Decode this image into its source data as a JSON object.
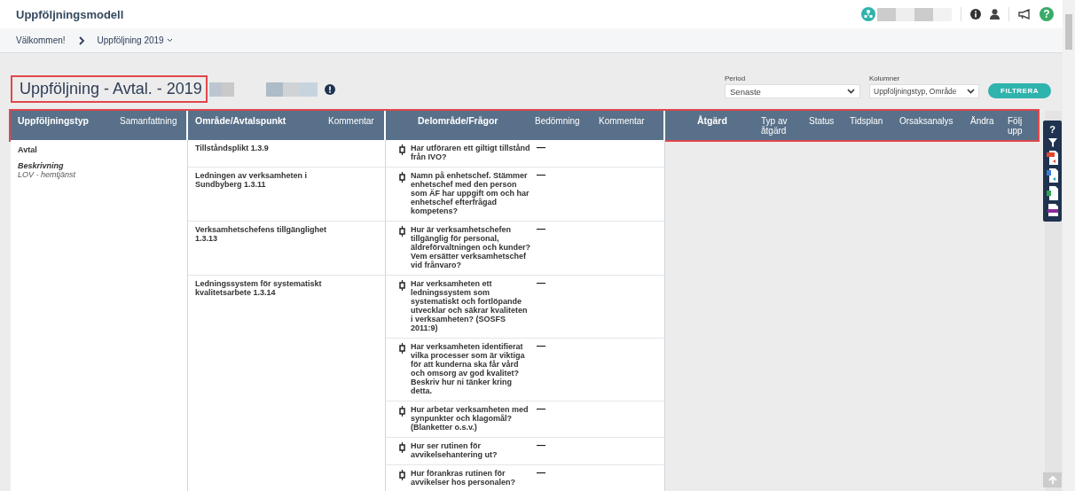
{
  "app": {
    "title": "Uppföljningsmodell",
    "help": "?"
  },
  "breadcrumb": [
    {
      "label": "Välkommen!",
      "has_menu": false
    },
    {
      "label": "Uppföljning 2019",
      "has_menu": true
    }
  ],
  "page_title": "Uppföljning - Avtal. - 2019",
  "filters": [
    {
      "label": "Period",
      "value": "Senaste"
    },
    {
      "label": "Kolumner",
      "value": "Uppföljningstyp, Område"
    }
  ],
  "filter_button": "FILTRERA",
  "table": {
    "column_groups": [
      {
        "columns": [
          {
            "label": "Uppföljningstyp",
            "primary": true
          },
          {
            "label": "Samanfattning",
            "primary": false
          }
        ]
      },
      {
        "columns": [
          {
            "label": "Område/Avtalspunkt",
            "primary": true
          },
          {
            "label": "Kommentar",
            "primary": false
          }
        ]
      },
      {
        "columns": [
          {
            "label": "Delområde/Frågor",
            "primary": true
          },
          {
            "label": "Bedömning",
            "primary": false
          },
          {
            "label": "Kommentar",
            "primary": false
          }
        ]
      },
      {
        "columns": [
          {
            "label": "Åtgärd",
            "primary": true
          },
          {
            "label": "Typ av åtgärd",
            "primary": false
          },
          {
            "label": "Status",
            "primary": false
          },
          {
            "label": "Tidsplan",
            "primary": false
          },
          {
            "label": "Orsaksanalys",
            "primary": false
          },
          {
            "label": "Ändra",
            "primary": false
          },
          {
            "label": "Följ upp",
            "primary": false
          }
        ]
      }
    ],
    "type": {
      "name": "Avtal",
      "description_label": "Beskrivning",
      "description": "LOV - hemtjänst"
    },
    "areas": [
      {
        "title": "Tillståndsplikt 1.3.9",
        "questions": [
          {
            "text": "Har utföraren ett giltigt tillstånd från IVO?",
            "assessment": "—"
          }
        ]
      },
      {
        "title": "Ledningen av verksamheten i Sundbyberg 1.3.11",
        "questions": [
          {
            "text": "Namn på enhetschef. Stämmer enhetschef med den person som ÄF har uppgift om och har enhetschef efterfrågad kompetens?",
            "assessment": "—"
          }
        ]
      },
      {
        "title": "Verksamhetschefens tillgänglighet 1.3.13",
        "questions": [
          {
            "text": "Hur är verksamhetschefen tillgänglig för personal, äldreförvaltningen och kunder? Vem ersätter verksamhetschef vid frånvaro?",
            "assessment": "—"
          }
        ]
      },
      {
        "title": "Ledningssystem för systematiskt kvalitetsarbete 1.3.14",
        "questions": [
          {
            "text": "Har verksamheten ett ledningssystem som systematiskt och fortlöpande utvecklar och säkrar kvaliteten i verksamheten? (SOSFS 2011:9)",
            "assessment": "—"
          },
          {
            "text": "Har verksamheten identifierat vilka processer som är viktiga för att kunderna ska får vård och omsorg av god kvalitet? Beskriv hur ni tänker kring detta.",
            "assessment": "—"
          },
          {
            "text": "Hur arbetar verksamheten med synpunkter och klagomål? (Blanketter o.s.v.)",
            "assessment": "—"
          },
          {
            "text": "Hur ser rutinen för avvikelsehantering ut?",
            "assessment": "—"
          },
          {
            "text": "Hur förankras rutinen för avvikelser hos personalen?",
            "assessment": "—"
          }
        ]
      }
    ]
  },
  "toolbar": {
    "help": "?"
  }
}
